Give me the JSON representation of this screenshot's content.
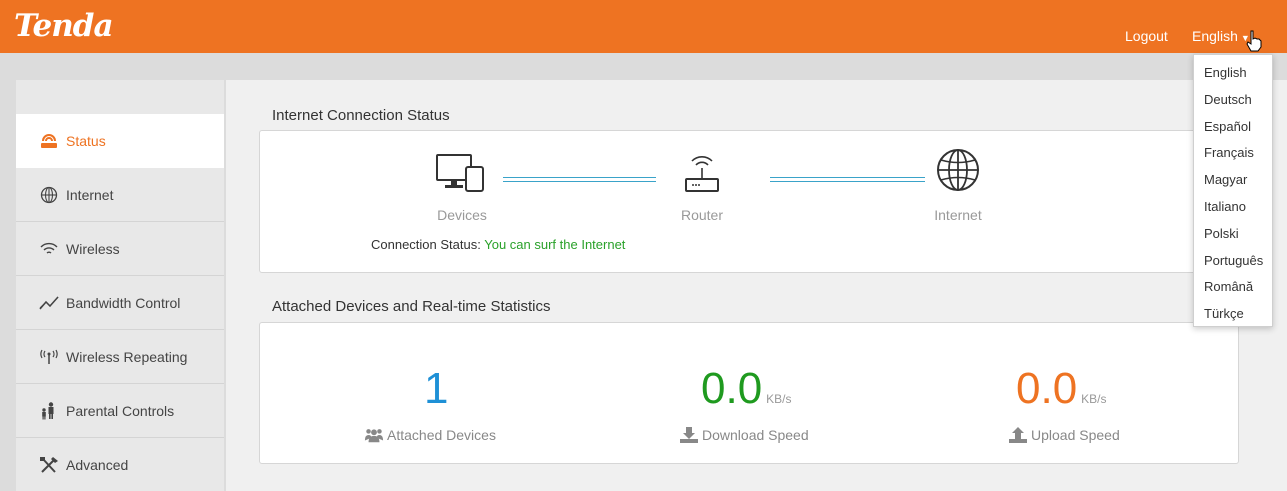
{
  "header": {
    "logo": "Tenda",
    "logout_label": "Logout",
    "language_label": "English"
  },
  "language_menu": {
    "options": [
      "English",
      "Deutsch",
      "Español",
      "Français",
      "Magyar",
      "Italiano",
      "Polski",
      "Português",
      "Română",
      "Türkçe"
    ]
  },
  "sidebar": {
    "items": [
      {
        "label": "Status",
        "icon": "router-signal-icon",
        "active": true
      },
      {
        "label": "Internet",
        "icon": "globe-icon"
      },
      {
        "label": "Wireless",
        "icon": "wifi-icon"
      },
      {
        "label": "Bandwidth Control",
        "icon": "bandwidth-icon"
      },
      {
        "label": "Wireless Repeating",
        "icon": "repeater-icon"
      },
      {
        "label": "Parental Controls",
        "icon": "parent-child-icon"
      },
      {
        "label": "Advanced",
        "icon": "tools-icon"
      }
    ]
  },
  "connection": {
    "title": "Internet Connection Status",
    "devices_label": "Devices",
    "router_label": "Router",
    "internet_label": "Internet",
    "status_label": "Connection Status:",
    "status_value": "You can surf the Internet"
  },
  "stats": {
    "title": "Attached Devices and Real-time Statistics",
    "attached_value": "1",
    "attached_label": "Attached Devices",
    "download_value": "0.0",
    "download_unit": "KB/s",
    "download_label": "Download Speed",
    "upload_value": "0.0",
    "upload_unit": "KB/s",
    "upload_label": "Upload Speed"
  },
  "colors": {
    "brand": "#ee7322",
    "blue": "#1e90d6",
    "green": "#1f9a1f",
    "orange": "#ee7322"
  }
}
